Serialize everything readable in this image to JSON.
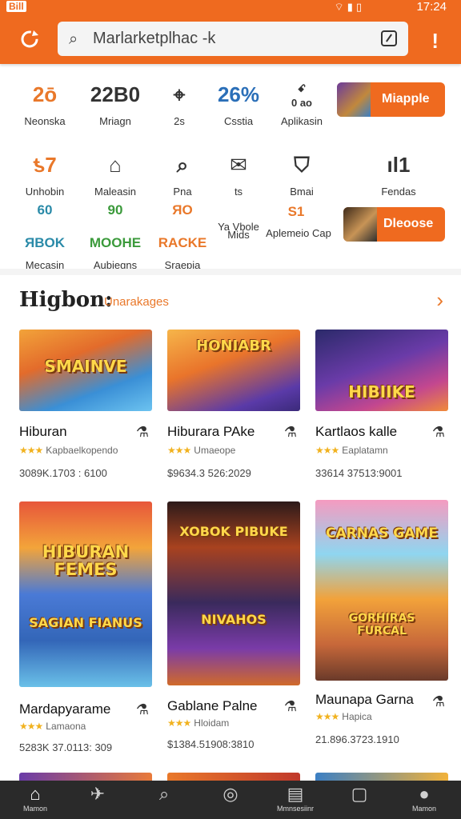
{
  "status": {
    "badge": "Bill",
    "time": "17:24",
    "icons": "wifi-icon signal-icon battery-icon"
  },
  "search": {
    "value": "Marlarketplhac -k"
  },
  "categories": [
    {
      "glyph": "2ō",
      "label": "Neonska"
    },
    {
      "glyph": "22B0",
      "label": "Mriagn"
    },
    {
      "glyph": "⌖",
      "label": "2s"
    },
    {
      "glyph": "26%",
      "label": "Csstia"
    },
    {
      "glyph": "ꗃ\n0 ao",
      "label": "Aplikasin"
    },
    {
      "glyph": "ƾ7",
      "label": "Unhobin"
    },
    {
      "glyph": "⌂",
      "label": "Maleasin"
    },
    {
      "glyph": "⌕",
      "label": "Pna"
    },
    {
      "glyph": "✉",
      "label": "ts"
    },
    {
      "glyph": "⛉",
      "label": "Bmai"
    },
    {
      "glyph": "ıl1",
      "label": "Fendas"
    },
    {
      "glyph": "ЯBOK",
      "top": "60",
      "label": "Mecasin"
    },
    {
      "glyph": "MOOHE",
      "top": "90",
      "label": "Aubiegns"
    },
    {
      "glyph": "RACKE",
      "top": "ЯO",
      "label": "Sraepia"
    },
    {
      "glyph": "Ya Vbole",
      "label": "Mids"
    },
    {
      "glyph": "S1",
      "label": "Aplemeio Cap"
    }
  ],
  "promos": [
    {
      "label": "Miapple"
    },
    {
      "label": "Dleoose"
    }
  ],
  "section": {
    "title": "Higbon:",
    "subtitle": "Unarakages"
  },
  "cards": [
    {
      "banner": "SMAINVE",
      "title": "Hiburan",
      "rating": "Kapbaelkopendo",
      "meta": "3089K.1703 : 6100"
    },
    {
      "banner": "HONIABR",
      "title": "Hiburara PAke",
      "rating": "Umaeope",
      "meta": "$9634.3 526:2029"
    },
    {
      "banner": "HIBIIKE",
      "title": "Kartlaos kalle",
      "rating": "Eaplatamn",
      "meta": "33614 37513:9001"
    },
    {
      "banner": "HIBURAN FEMES",
      "banner2": "SAGIAN FIANUS",
      "title": "Mardapyarame",
      "rating": "Lamaona",
      "meta": "5283K 37.0113: 309"
    },
    {
      "banner": "XOBOK PIBUKE",
      "banner2": "NIVAHOS",
      "title": "Gablane Palne",
      "rating": "Hloidam",
      "meta": "$1384.51908:3810"
    },
    {
      "banner": "CARNAS GAME",
      "banner2": "GORHIRAS FURCAL",
      "title": "Maunapa Garna",
      "rating": "Hapica",
      "meta": "21.896.3723.1910"
    }
  ],
  "nav": [
    {
      "icon": "home-icon",
      "glyph": "⌂",
      "label": "Mamon"
    },
    {
      "icon": "plane-icon",
      "glyph": "✈",
      "label": ""
    },
    {
      "icon": "search-icon",
      "glyph": "⌕",
      "label": ""
    },
    {
      "icon": "compass-icon",
      "glyph": "◎",
      "label": ""
    },
    {
      "icon": "news-icon",
      "glyph": "▤",
      "label": "Mmnsesiinr"
    },
    {
      "icon": "square-icon",
      "glyph": "▢",
      "label": ""
    },
    {
      "icon": "profile-icon",
      "glyph": "●",
      "label": "Mamon"
    }
  ],
  "colors": {
    "accent": "#ef6a1f",
    "nav_bg": "#2a2a2a",
    "star": "#f1b21f"
  }
}
